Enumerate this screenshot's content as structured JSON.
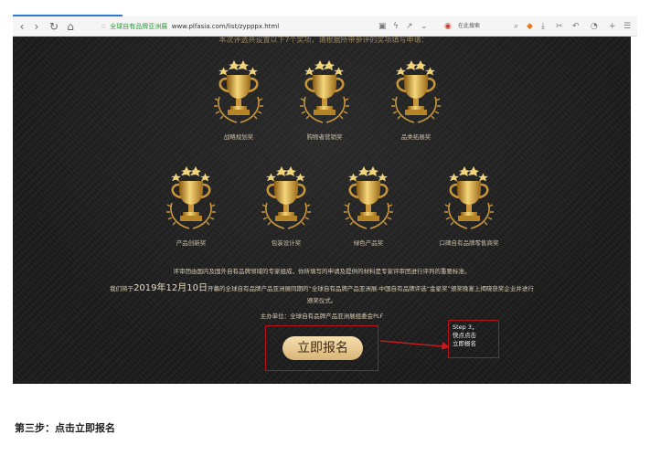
{
  "browser": {
    "url_site": "全球自有品牌亚洲展",
    "url": "www.plfasia.com/list/zypppx.html",
    "search_label": "在此搜索"
  },
  "page": {
    "intro": "本次评选共设置以下7个奖项，请根据所带参评的奖项填写申请：",
    "awards_row1": [
      {
        "label": "战略规划奖"
      },
      {
        "label": "购物者营销奖"
      },
      {
        "label": "品类拓展奖"
      }
    ],
    "awards_row2": [
      {
        "label": "产品创新奖"
      },
      {
        "label": "包装设计奖"
      },
      {
        "label": "绿色产品奖"
      },
      {
        "label": "口碑自有品牌零售商奖"
      }
    ],
    "description": {
      "line1": "评审团由国内及国外自有品牌领域的专家组成，你所填写的申请及提供的材料是专家评审团进行评判的重要标准。",
      "line2_pre": "我们将于",
      "line2_date": "2019年12月10日",
      "line2_post": "开幕的全球自有品牌产品亚洲展同期的“全球自有品牌产品亚洲展-中国自有品牌评选“金星奖”颁奖晚宴上揭晓获奖企业并进行",
      "line3": "颁奖仪式。",
      "organizer": "主办单位：全球自有品牌产品亚洲展组委会PLF"
    },
    "signup_button": "立即报名",
    "callout": {
      "line1": "Step 3，",
      "line2": "快点点击",
      "line3": "立即报名"
    }
  },
  "caption": "第三步：点击立即报名",
  "colors": {
    "gold": "#d8a93a",
    "annotation_red": "#b3151b",
    "button": "#e8c98f"
  }
}
